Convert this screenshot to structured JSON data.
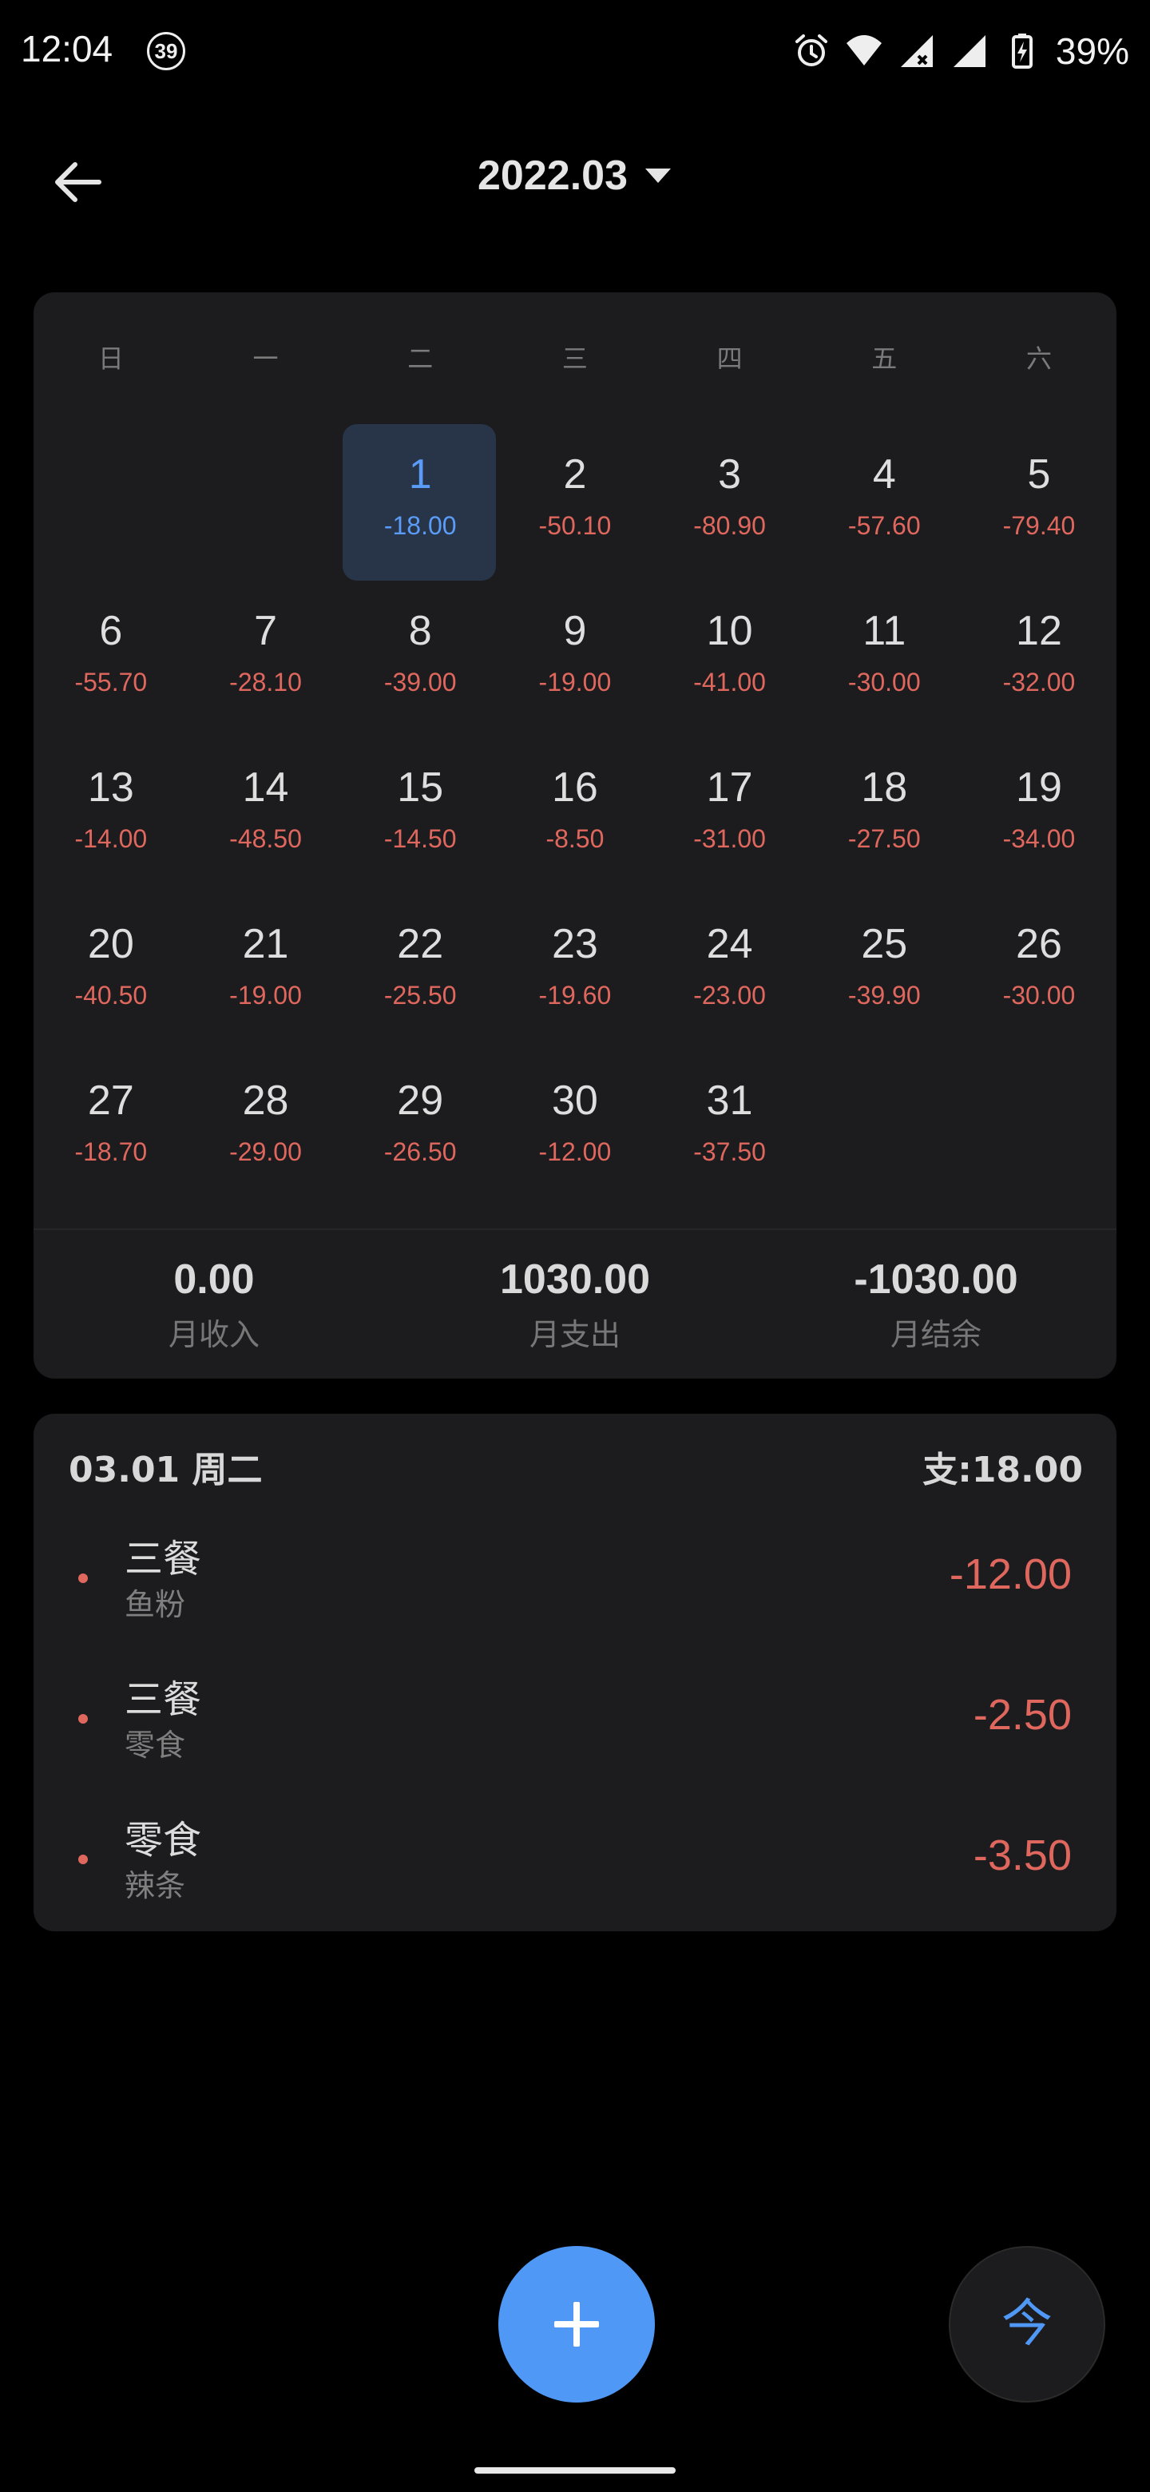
{
  "status_bar": {
    "time": "12:04",
    "notification_count": "39",
    "battery": "39%"
  },
  "header": {
    "title": "2022.03"
  },
  "weekdays": [
    "日",
    "一",
    "二",
    "三",
    "四",
    "五",
    "六"
  ],
  "calendar": {
    "weeks": [
      [
        {
          "day": "",
          "amount": ""
        },
        {
          "day": "",
          "amount": ""
        },
        {
          "day": "1",
          "amount": "-18.00",
          "selected": true
        },
        {
          "day": "2",
          "amount": "-50.10"
        },
        {
          "day": "3",
          "amount": "-80.90"
        },
        {
          "day": "4",
          "amount": "-57.60"
        },
        {
          "day": "5",
          "amount": "-79.40"
        }
      ],
      [
        {
          "day": "6",
          "amount": "-55.70"
        },
        {
          "day": "7",
          "amount": "-28.10"
        },
        {
          "day": "8",
          "amount": "-39.00"
        },
        {
          "day": "9",
          "amount": "-19.00"
        },
        {
          "day": "10",
          "amount": "-41.00"
        },
        {
          "day": "11",
          "amount": "-30.00"
        },
        {
          "day": "12",
          "amount": "-32.00"
        }
      ],
      [
        {
          "day": "13",
          "amount": "-14.00"
        },
        {
          "day": "14",
          "amount": "-48.50"
        },
        {
          "day": "15",
          "amount": "-14.50"
        },
        {
          "day": "16",
          "amount": "-8.50"
        },
        {
          "day": "17",
          "amount": "-31.00"
        },
        {
          "day": "18",
          "amount": "-27.50"
        },
        {
          "day": "19",
          "amount": "-34.00"
        }
      ],
      [
        {
          "day": "20",
          "amount": "-40.50"
        },
        {
          "day": "21",
          "amount": "-19.00"
        },
        {
          "day": "22",
          "amount": "-25.50"
        },
        {
          "day": "23",
          "amount": "-19.60"
        },
        {
          "day": "24",
          "amount": "-23.00"
        },
        {
          "day": "25",
          "amount": "-39.90"
        },
        {
          "day": "26",
          "amount": "-30.00"
        }
      ],
      [
        {
          "day": "27",
          "amount": "-18.70"
        },
        {
          "day": "28",
          "amount": "-29.00"
        },
        {
          "day": "29",
          "amount": "-26.50"
        },
        {
          "day": "30",
          "amount": "-12.00"
        },
        {
          "day": "31",
          "amount": "-37.50"
        },
        {
          "day": "",
          "amount": ""
        },
        {
          "day": "",
          "amount": ""
        }
      ]
    ]
  },
  "summary": {
    "income": {
      "value": "0.00",
      "label": "月收入"
    },
    "expense": {
      "value": "1030.00",
      "label": "月支出"
    },
    "balance": {
      "value": "-1030.00",
      "label": "月结余"
    }
  },
  "day_detail": {
    "date": "03.01 周二",
    "total": "支:18.00",
    "entries": [
      {
        "category": "三餐",
        "note": "鱼粉",
        "amount": "-12.00"
      },
      {
        "category": "三餐",
        "note": "零食",
        "amount": "-2.50"
      },
      {
        "category": "零食",
        "note": "辣条",
        "amount": "-3.50"
      }
    ]
  },
  "buttons": {
    "add_icon": "plus-icon",
    "today_label": "今"
  },
  "colors": {
    "accent": "#4f98f6",
    "expense": "#e0675e",
    "card": "#1c1c1e",
    "selected_bg": "#283448"
  }
}
